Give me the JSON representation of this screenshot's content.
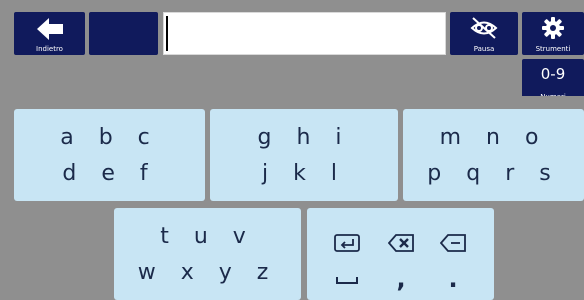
{
  "toolbar": {
    "back_label": "Indietro",
    "pause_label": "Pausa",
    "tools_label": "Strumenti",
    "numbers_label": "Numeri",
    "numbers_key": "0-9"
  },
  "text_field": {
    "value": ""
  },
  "keys": [
    {
      "row1": "a b c",
      "row2": "d e f"
    },
    {
      "row1": "g h i",
      "row2": "j k l"
    },
    {
      "row1": "m n o",
      "row2": "p q r s"
    },
    {
      "row1": "t u v",
      "row2": "w x y z"
    }
  ],
  "special_key": {
    "comma": ",",
    "period": "."
  },
  "colors": {
    "toolbar_button": "#101a5c",
    "key_background": "#c8e5f4",
    "background": "#8f8f8f"
  },
  "icons": [
    "back-arrow-icon",
    "eye-closed-icon",
    "gear-icon",
    "enter-icon",
    "backspace-icon",
    "delete-left-icon",
    "space-icon"
  ]
}
